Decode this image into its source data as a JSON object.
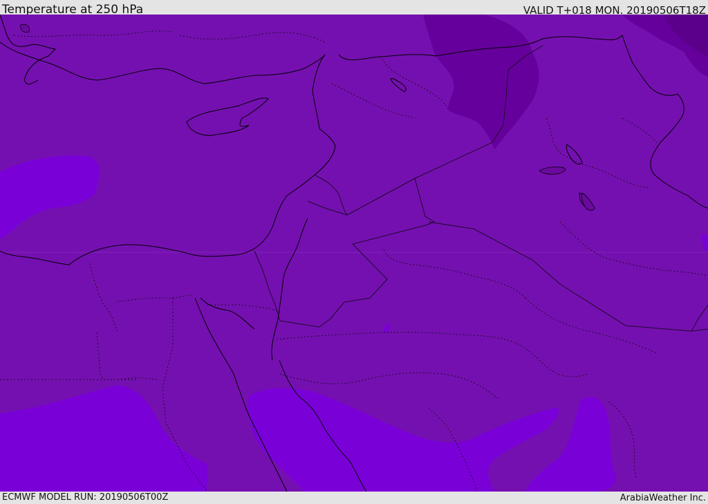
{
  "header": {
    "title": "Temperature at 250 hPa",
    "valid": "VALID T+018 MON. 20190506T18Z"
  },
  "footer": {
    "model_run": "ECMWF MODEL RUN: 20190506T00Z",
    "credit": "ArabiaWeather Inc."
  },
  "colors": {
    "base_fill": "#7510b0",
    "warm_fill": "#7a00d8",
    "cold_fill": "#660098",
    "coldest_fill": "#5a008a",
    "coast_line": "#000000",
    "border_line": "#2a1040",
    "frame_bg": "#e4e4e4"
  },
  "map": {
    "field": "Temperature at 250 hPa",
    "region": "Eastern Mediterranean and Middle East",
    "layers": [
      "temperature-contours",
      "coastlines",
      "national-borders",
      "admin-boundaries"
    ]
  }
}
